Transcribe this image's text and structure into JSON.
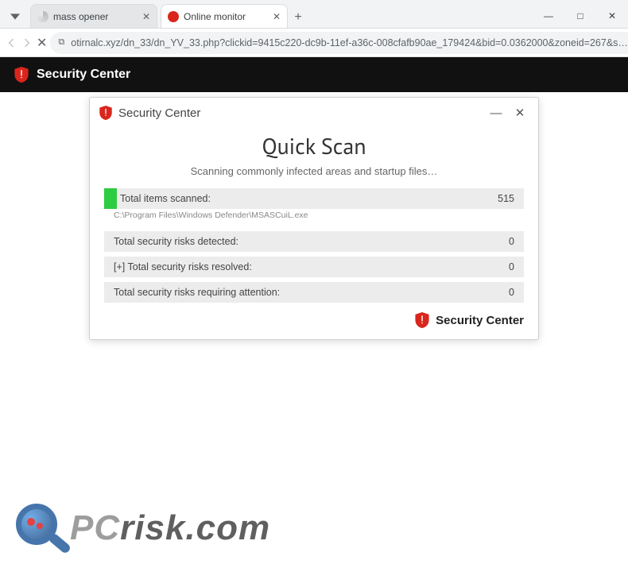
{
  "browser": {
    "tabs": [
      {
        "title": "mass opener",
        "favicon": "search"
      },
      {
        "title": "Online monitor",
        "favicon": "shield"
      }
    ],
    "url": "otirnalc.xyz/dn_33/dn_YV_33.php?clickid=9415c220-dc9b-11ef-a36c-008cfafb90ae_179424&bid=0.0362000&zoneid=267&s…"
  },
  "page_header": {
    "title": "Security Center"
  },
  "dialog": {
    "title": "Security Center",
    "heading": "Quick Scan",
    "subheading": "Scanning commonly infected areas and startup files…",
    "rows": [
      {
        "label": "Total items scanned:",
        "value": "515"
      },
      {
        "label": "Total security risks detected:",
        "value": "0"
      },
      {
        "label": "[+] Total security risks resolved:",
        "value": "0"
      },
      {
        "label": "Total security risks requiring attention:",
        "value": "0"
      }
    ],
    "current_path": "C:\\Program Files\\Windows Defender\\MSASCuiL.exe",
    "footer_brand": "Security Center"
  },
  "watermark": {
    "pre": "PC",
    "post": "risk.com"
  },
  "colors": {
    "shield_primary": "#d9261c",
    "accent_green": "#2ecc40",
    "dark_bar": "#111111"
  }
}
